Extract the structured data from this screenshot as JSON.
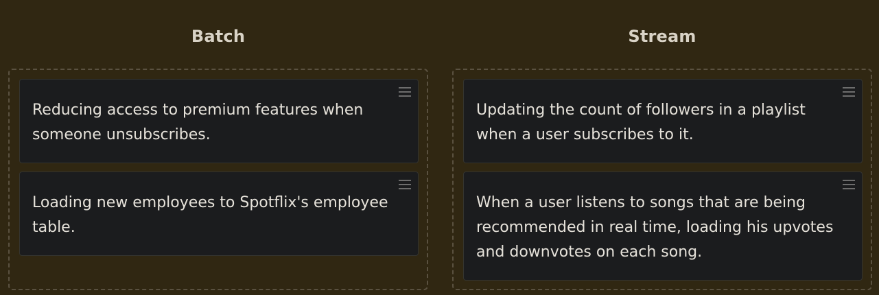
{
  "columns": [
    {
      "title": "Batch",
      "cards": [
        {
          "text": "Reducing access to premium features when someone unsubscribes."
        },
        {
          "text": "Loading new employees to Spotflix's employee table."
        }
      ]
    },
    {
      "title": "Stream",
      "cards": [
        {
          "text": "Updating the count of followers in a playlist when a user subscribes to it."
        },
        {
          "text": "When a user listens to songs that are being recommended in real time, loading his upvotes and downvotes on each song."
        }
      ]
    }
  ],
  "icons": {
    "drag_handle": "hamburger-drag-icon"
  },
  "colors": {
    "background": "#302712",
    "card_background": "#1b1c1e",
    "title_text": "#d9d3c6",
    "card_text": "#e6e2da",
    "dropzone_border": "#5a5140"
  }
}
